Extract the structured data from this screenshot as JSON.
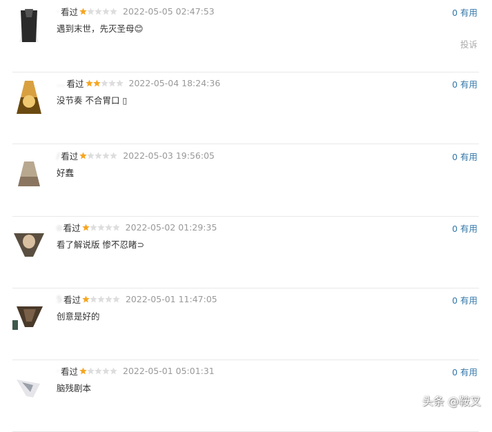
{
  "reviews": [
    {
      "name_fragment": "·",
      "watched": "看过",
      "rating": 1,
      "time": "2022-05-05 02:47:53",
      "text": "遇到末世，先灭圣母😊",
      "useful": "0 有用",
      "report": "投诉"
    },
    {
      "name_fragment": "…",
      "watched": "看过",
      "rating": 2,
      "time": "2022-05-04 18:24:36",
      "text": "没节奏 不合胃口 ▯",
      "useful": "0 有用"
    },
    {
      "name_fragment": "/",
      "watched": "看过",
      "rating": 1,
      "time": "2022-05-03 19:56:05",
      "text": "好蠢",
      "useful": "0 有用"
    },
    {
      "name_fragment": "o",
      "watched": "看过",
      "rating": 1,
      "time": "2022-05-02 01:29:35",
      "text": "看了解说版 惨不忍睹⊃",
      "useful": "0 有用"
    },
    {
      "name_fragment": "5",
      "watched": "看过",
      "rating": 1,
      "time": "2022-05-01 11:47:05",
      "text": "创意是好的",
      "useful": "0 有用"
    },
    {
      "name_fragment": "·",
      "watched": "看过",
      "rating": 1,
      "time": "2022-05-01 05:01:31",
      "text": "脑残剧本",
      "useful": "0 有用"
    }
  ],
  "watermark": "头条 @鞍叉",
  "colors": {
    "star_on": "#f5a623",
    "star_off": "#dddddd",
    "link": "#3377aa",
    "time": "#999999"
  },
  "icons": {
    "star": "star-icon"
  }
}
